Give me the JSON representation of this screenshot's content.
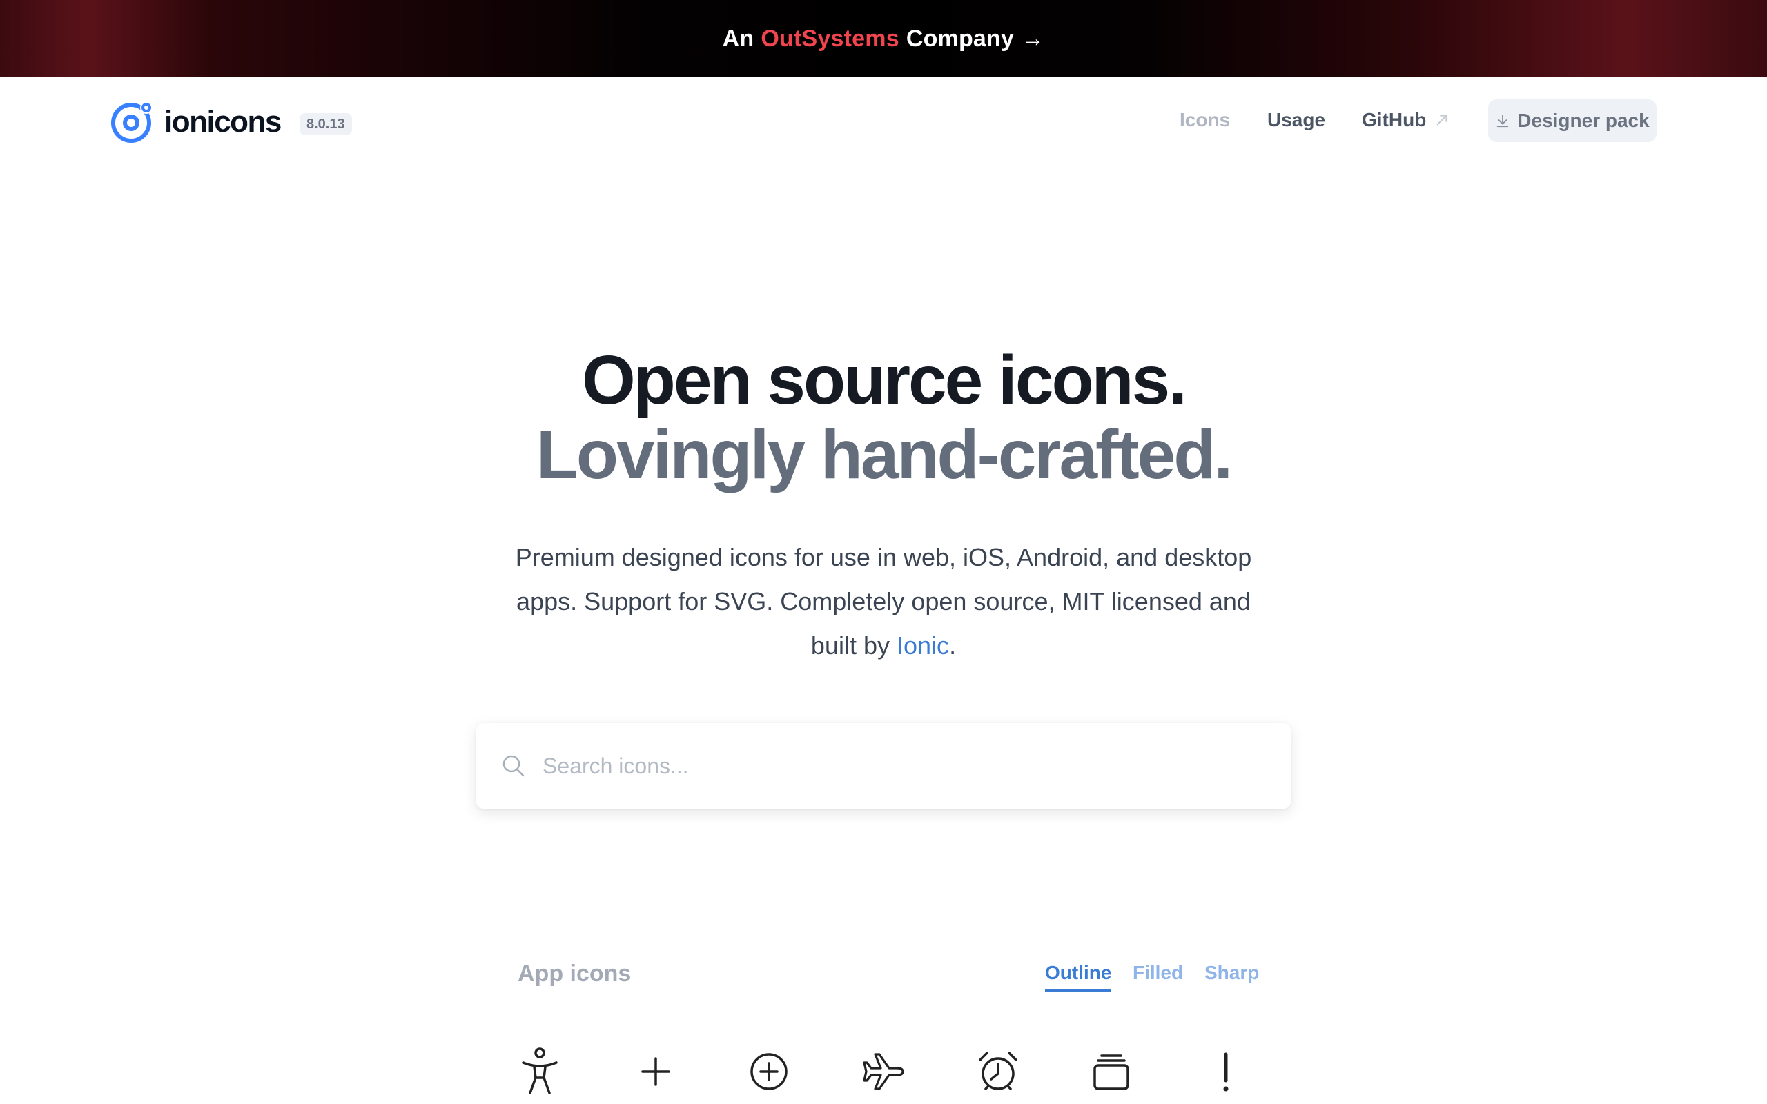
{
  "banner": {
    "prefix": "An",
    "brand": "OutSystems",
    "suffix": "Company",
    "arrow": "→",
    "brand_color": "#f0454f"
  },
  "header": {
    "logo_text": "ionicons",
    "version": "8.0.13",
    "nav": {
      "icons": "Icons",
      "usage": "Usage",
      "github": "GitHub",
      "designer_pack": "Designer pack"
    }
  },
  "hero": {
    "title_line1": "Open source icons.",
    "title_line2": "Lovingly hand-crafted.",
    "description_part1": "Premium designed icons for use in web, iOS, Android, and desktop apps. Support for SVG. Completely open source, MIT licensed and built by",
    "description_link": "Ionic",
    "description_end": "."
  },
  "search": {
    "placeholder": "Search icons..."
  },
  "section": {
    "title": "App icons",
    "tabs": [
      "Outline",
      "Filled",
      "Sharp"
    ],
    "active_tab": "Outline",
    "icons": [
      "accessibility-icon",
      "add-icon",
      "add-circle-icon",
      "airplane-icon",
      "alarm-icon",
      "albums-icon",
      "alert-icon"
    ]
  },
  "colors": {
    "accent": "#3a7bd5",
    "heading": "#151a23",
    "subheading": "#646d7b"
  }
}
